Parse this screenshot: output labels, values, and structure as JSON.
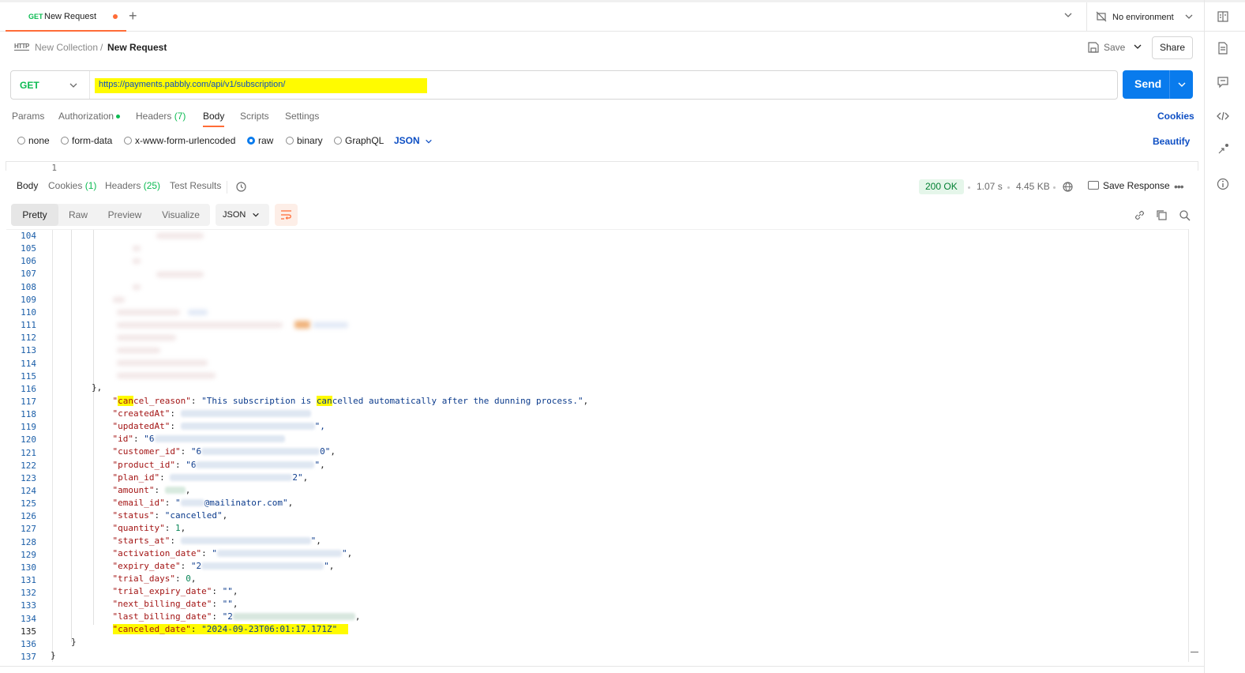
{
  "tab": {
    "method": "GET",
    "name": "New Request"
  },
  "environment": {
    "label": "No environment"
  },
  "breadcrumb": {
    "collection": "New Collection",
    "separator": "/",
    "request": "New Request"
  },
  "actions": {
    "save": "Save",
    "share": "Share"
  },
  "url_bar": {
    "method": "GET",
    "url": "https://payments.pabbly.com/api/v1/subscription/",
    "send": "Send"
  },
  "request_tabs": [
    {
      "label": "Params"
    },
    {
      "label": "Authorization"
    },
    {
      "label": "Headers",
      "count": "(7)"
    },
    {
      "label": "Body"
    },
    {
      "label": "Scripts"
    },
    {
      "label": "Settings"
    }
  ],
  "cookies_link": "Cookies",
  "body_types": [
    "none",
    "form-data",
    "x-www-form-urlencoded",
    "raw",
    "binary",
    "GraphQL"
  ],
  "body_format": "JSON",
  "beautify": "Beautify",
  "request_editor": {
    "first_line": "1"
  },
  "response_tabs": [
    {
      "label": "Body"
    },
    {
      "label": "Cookies",
      "count": "(1)"
    },
    {
      "label": "Headers",
      "count": "(25)"
    },
    {
      "label": "Test Results"
    }
  ],
  "response_meta": {
    "status": "200 OK",
    "time": "1.07 s",
    "size": "4.45 KB",
    "save_response": "Save Response"
  },
  "view_modes": [
    "Pretty",
    "Raw",
    "Preview",
    "Visualize"
  ],
  "view_format": "JSON",
  "line_numbers": [
    "104",
    "105",
    "106",
    "107",
    "108",
    "109",
    "110",
    "111",
    "112",
    "113",
    "114",
    "115",
    "116",
    "117",
    "118",
    "119",
    "120",
    "121",
    "122",
    "123",
    "124",
    "125",
    "126",
    "127",
    "128",
    "129",
    "130",
    "131",
    "132",
    "133",
    "134",
    "135",
    "136",
    "137"
  ],
  "code": {
    "l116": "},",
    "cancel_reason_key_a": "can",
    "cancel_reason_key_b": "cel_reason",
    "cancel_reason_val_a": "This subscription is ",
    "cancel_reason_val_hl": "can",
    "cancel_reason_val_b": "celled automatically after the dunning process.",
    "createdAt": "createdAt",
    "updatedAt": "updatedAt",
    "updatedAt_partial": "2024-09-23T06:01:17.171Z",
    "id": "id",
    "id_partial": "6",
    "customer_id": "customer_id",
    "customer_id_partial_a": "6",
    "customer_id_partial_b": "0",
    "product_id": "product_id",
    "product_id_partial": "6",
    "plan_id": "plan_id",
    "plan_id_partial": "2",
    "amount": "amount",
    "email_id": "email_id",
    "email_suffix": "@mailinator.com",
    "status": "status",
    "status_val": "cancelled",
    "quantity": "quantity",
    "quantity_val": "1",
    "starts_at": "starts_at",
    "activation_date": "activation_date",
    "expiry_date": "expiry_date",
    "expiry_partial": "2",
    "trial_days": "trial_days",
    "trial_days_val": "0",
    "trial_expiry_date": "trial_expiry_date",
    "next_billing_date": "next_billing_date",
    "last_billing_date": "last_billing_date",
    "last_billing_partial": "2",
    "canceled_date": "canceled_date",
    "canceled_date_val": "2024-09-23T06:01:17.171Z",
    "l136": "}",
    "l137": "}"
  },
  "colors": {
    "accent": "#ff6c37",
    "send": "#097bed",
    "get": "#0cbb52",
    "highlight": "#fffb00"
  }
}
